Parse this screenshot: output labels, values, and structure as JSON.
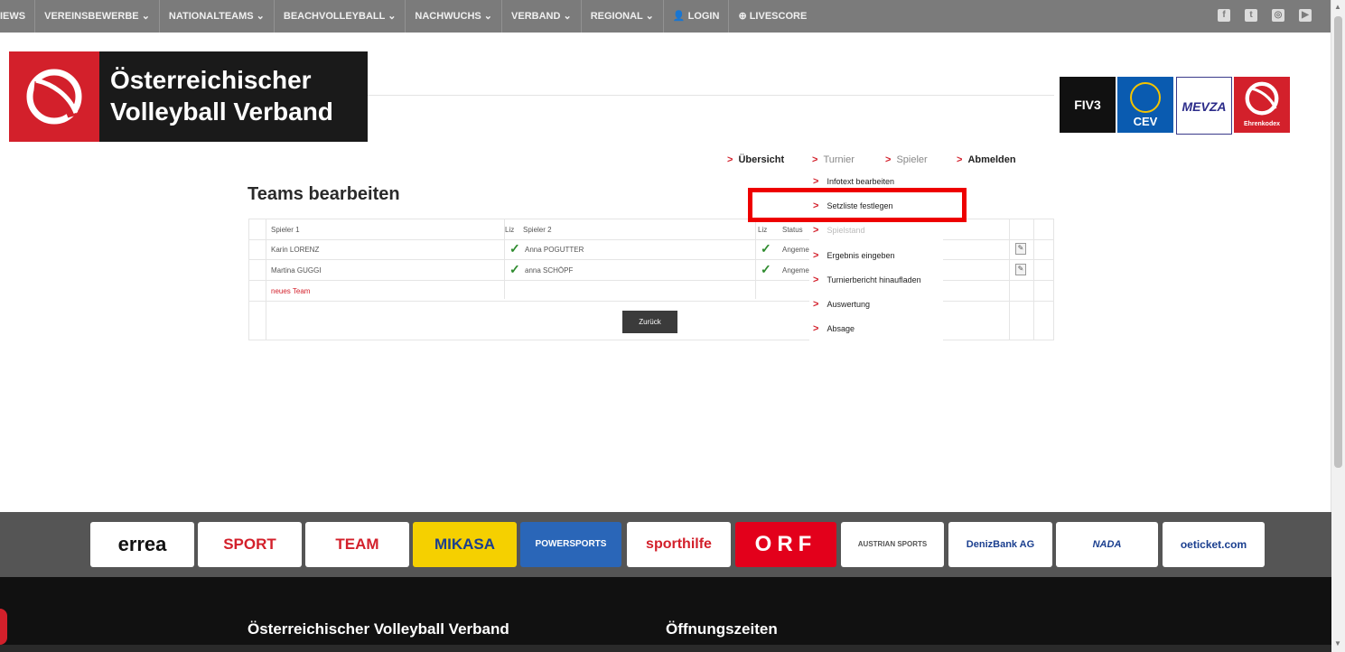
{
  "topnav": {
    "items": [
      "IEWS",
      "VEREINSBEWERBE ⌄",
      "NATIONALTEAMS ⌄",
      "BEACHVOLLEYBALL ⌄",
      "NACHWUCHS ⌄",
      "VERBAND ⌄",
      "REGIONAL ⌄",
      "👤 LOGIN",
      "⊕ LIVESCORE"
    ],
    "social": [
      "f",
      "t",
      "◎",
      "▶"
    ]
  },
  "brand": {
    "line1": "Österreichischer",
    "line2": "Volleyball Verband"
  },
  "partners": {
    "fivb": "FIV3",
    "cev": "CEV",
    "mevza": "MEVZA",
    "ehrenkodex": "Ehrenkodex"
  },
  "subnav": {
    "uebersicht": "Übersicht",
    "turnier": "Turnier",
    "spieler": "Spieler",
    "abmelden": "Abmelden"
  },
  "page_title": "Teams bearbeiten",
  "table": {
    "headers": {
      "spieler1": "Spieler 1",
      "liz1": "Liz",
      "spieler2": "Spieler 2",
      "liz2": "Liz",
      "status": "Status"
    },
    "rows": [
      {
        "spieler1": "Karin LORENZ",
        "spieler2": "Anna POGUTTER",
        "status": "Angeme"
      },
      {
        "spieler1": "Martina GUGGI",
        "spieler2": "anna SCHÖPF",
        "status": "Angeme"
      }
    ],
    "new_team": "neues Team",
    "back_button": "Zurück"
  },
  "dropdown": {
    "items": [
      "Infotext bearbeiten",
      "Setzliste festlegen",
      "Spielstand",
      "Ergebnis eingeben",
      "Turnierbericht hinaufladen",
      "Auswertung",
      "Absage"
    ]
  },
  "sponsors": [
    "errea",
    "SPORT",
    "TEAM",
    "MIKASA",
    "POWERSPORTS",
    "sporthilfe",
    "ORF",
    "AUSTRIAN SPORTS",
    "DenizBank AG",
    "NADA",
    "oeticket.com"
  ],
  "footer": {
    "col1": "Österreichischer Volleyball Verband",
    "col2": "Öffnungszeiten"
  },
  "colors": {
    "brand_red": "#d3202b",
    "nav_gray": "#7b7b7b",
    "highlight": "#ee0000"
  }
}
